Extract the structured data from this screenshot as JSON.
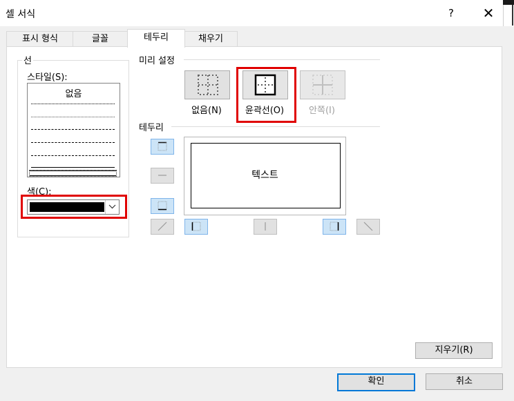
{
  "window": {
    "title": "셀 서식",
    "help_glyph": "?",
    "close_glyph": "✕"
  },
  "tabs": [
    {
      "label": "표시 형식",
      "active": false
    },
    {
      "label": "글꼴",
      "active": false
    },
    {
      "label": "테두리",
      "active": true
    },
    {
      "label": "채우기",
      "active": false
    }
  ],
  "line_group": {
    "title": "선",
    "style_label": "스타일(S):",
    "style_none": "없음",
    "color_label": "색(C):",
    "color_value": "#000000"
  },
  "presets": {
    "title": "미리 설정",
    "items": [
      {
        "label": "없음(N)",
        "icon": "border-none-icon",
        "enabled": true
      },
      {
        "label": "윤곽선(O)",
        "icon": "border-outline-icon",
        "enabled": true,
        "selected": true
      },
      {
        "label": "안쪽(I)",
        "icon": "border-inside-icon",
        "enabled": false
      }
    ]
  },
  "border_group": {
    "title": "테두리",
    "preview_text": "텍스트"
  },
  "buttons": {
    "clear": "지우기(R)",
    "ok": "확인",
    "cancel": "취소"
  },
  "colors": {
    "highlight": "#e00000",
    "selected_button": "#cce4f7",
    "accent": "#0078d7"
  }
}
